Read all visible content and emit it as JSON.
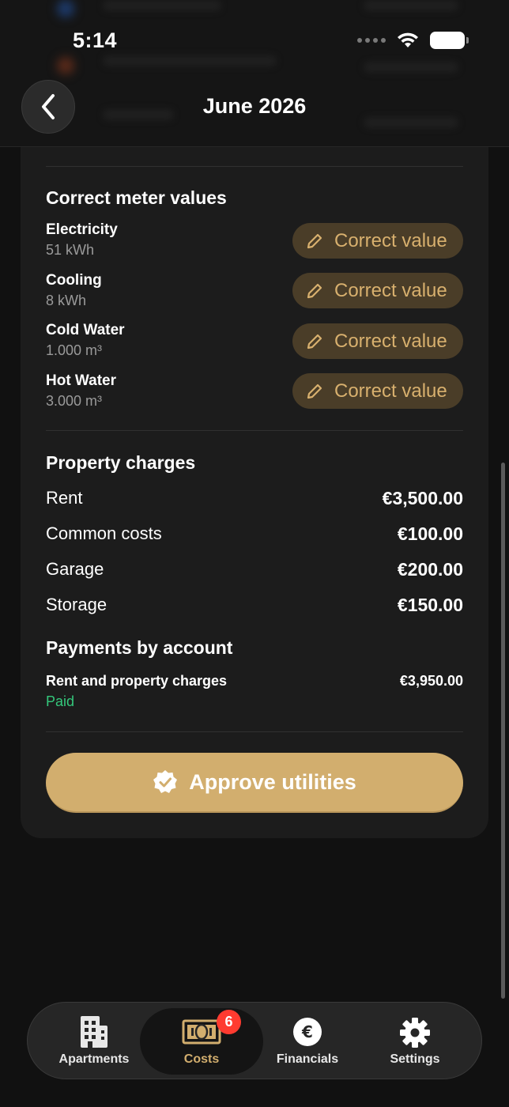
{
  "status_bar": {
    "time": "5:14"
  },
  "header": {
    "title": "June 2026"
  },
  "meters": {
    "section_title": "Correct meter values",
    "items": [
      {
        "name": "Electricity",
        "value": "51 kWh",
        "action": "Correct value"
      },
      {
        "name": "Cooling",
        "value": "8 kWh",
        "action": "Correct value"
      },
      {
        "name": "Cold Water",
        "value": "1.000 m³",
        "action": "Correct value"
      },
      {
        "name": "Hot Water",
        "value": "3.000 m³",
        "action": "Correct value"
      }
    ]
  },
  "property_charges": {
    "section_title": "Property charges",
    "items": [
      {
        "label": "Rent",
        "amount": "€3,500.00"
      },
      {
        "label": "Common costs",
        "amount": "€100.00"
      },
      {
        "label": "Garage",
        "amount": "€200.00"
      },
      {
        "label": "Storage",
        "amount": "€150.00"
      }
    ]
  },
  "payments": {
    "section_title": "Payments by account",
    "account_label": "Rent and property charges",
    "amount": "€3,950.00",
    "status": "Paid"
  },
  "approve_button": {
    "label": "Approve utilities"
  },
  "tabbar": {
    "items": [
      {
        "label": "Apartments",
        "icon": "building-icon"
      },
      {
        "label": "Costs",
        "icon": "banknote-icon",
        "badge": "6",
        "active": true
      },
      {
        "label": "Financials",
        "icon": "euro-icon"
      },
      {
        "label": "Settings",
        "icon": "gear-icon"
      }
    ]
  },
  "colors": {
    "accent": "#d2ae6e",
    "accent_text": "#d8b06e",
    "paid_green": "#34c77b",
    "badge_red": "#ff3b30"
  }
}
